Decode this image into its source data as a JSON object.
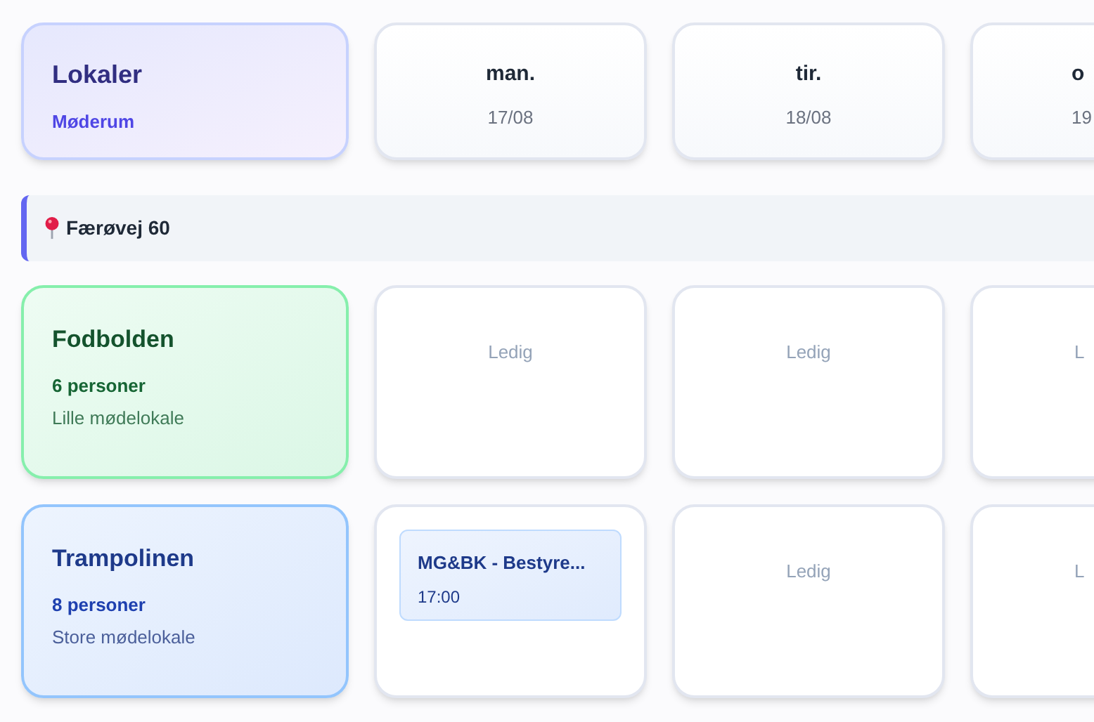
{
  "header": {
    "title": "Lokaler",
    "subtitle": "Møderum"
  },
  "days": [
    {
      "label": "man.",
      "date": "17/08",
      "cut": false
    },
    {
      "label": "tir.",
      "date": "18/08",
      "cut": false
    },
    {
      "label": "o",
      "date": "19",
      "cut": true
    }
  ],
  "location": {
    "name": "Færøvej 60"
  },
  "rooms": [
    {
      "name": "Fodbolden",
      "capacity": "6 personer",
      "description": "Lille mødelokale",
      "color": "#86efac",
      "cells": [
        {
          "kind": "free",
          "text": "Ledig"
        },
        {
          "kind": "free",
          "text": "Ledig"
        },
        {
          "kind": "free",
          "text": "L"
        }
      ]
    },
    {
      "name": "Trampolinen",
      "capacity": "8 personer",
      "description": "Store mødelokale",
      "color": "#93c5fd",
      "cells": [
        {
          "kind": "booking",
          "title": "MG&BK - Bestyre...",
          "time": "17:00"
        },
        {
          "kind": "free",
          "text": "Ledig"
        },
        {
          "kind": "free",
          "text": "L"
        }
      ]
    }
  ]
}
